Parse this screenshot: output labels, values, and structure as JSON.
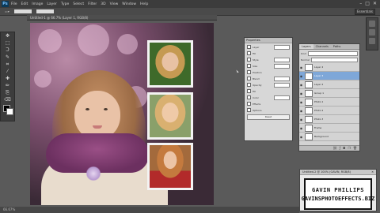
{
  "app": {
    "logo": "Ps"
  },
  "menubar": {
    "items": [
      "File",
      "Edit",
      "Image",
      "Layer",
      "Type",
      "Select",
      "Filter",
      "3D",
      "View",
      "Window",
      "Help"
    ]
  },
  "workspace": {
    "label": "Essentials"
  },
  "document": {
    "tab_title": "Untitled-1 @ 66.7% (Layer 1, RGB/8)"
  },
  "tools": {
    "icons": [
      "move-icon",
      "marquee-icon",
      "lasso-icon",
      "quick-select-icon",
      "crop-icon",
      "eyedropper-icon",
      "healing-icon",
      "brush-icon",
      "stamp-icon",
      "history-brush-icon",
      "eraser-icon",
      "gradient-icon",
      "blur-icon",
      "dodge-icon",
      "pen-icon",
      "type-icon",
      "path-select-icon",
      "shape-icon",
      "hand-icon",
      "zoom-icon"
    ],
    "glyphs": [
      "✥",
      "⬚",
      "ᑐ",
      "✎",
      "⌗",
      "⁄",
      "✚",
      "✏",
      "⎘",
      "↺",
      "⌫",
      "▦",
      "◐",
      "○",
      "✒",
      "T",
      "➤",
      "▭",
      "✋",
      "🔍"
    ]
  },
  "properties": {
    "title": "Properties",
    "rows": [
      "Layer",
      "Fill",
      "Style",
      "Size",
      "Position",
      "Blend",
      "Opacity",
      "Fill",
      "Color",
      "Effects",
      "Options"
    ],
    "button": "Reset"
  },
  "layers": {
    "tabs": [
      "Layers",
      "Channels",
      "Paths"
    ],
    "kind": "Kind",
    "mode": "Normal",
    "rows": [
      "Layer 4",
      "Layer 3",
      "Layer 2",
      "Group 1",
      "Photo 1",
      "Photo 2",
      "Photo 3",
      "Frame",
      "Background"
    ]
  },
  "watermark": {
    "title": "Untitled-2 @ 100% (GAVIN, RGB/8)",
    "name": "GAVIN PHILLIPS",
    "site": "GAVINSPHOTOEFFECTS.BIZ"
  },
  "status": {
    "zoom": "66.67%"
  },
  "colors": {
    "accent": "#7ea7d8",
    "panel_bg": "#d3d3d3",
    "workspace_bg": "#5a5a5a"
  }
}
